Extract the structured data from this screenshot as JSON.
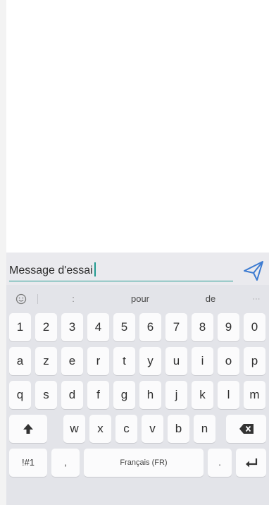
{
  "message": {
    "value": "Message d'essai"
  },
  "suggestions": {
    "left": ":",
    "center": "pour",
    "right": "de",
    "more": "···"
  },
  "keyboard": {
    "row_numbers": [
      "1",
      "2",
      "3",
      "4",
      "5",
      "6",
      "7",
      "8",
      "9",
      "0"
    ],
    "row_1": [
      "a",
      "z",
      "e",
      "r",
      "t",
      "y",
      "u",
      "i",
      "o",
      "p"
    ],
    "row_2": [
      "q",
      "s",
      "d",
      "f",
      "g",
      "h",
      "j",
      "k",
      "l",
      "m"
    ],
    "row_3": [
      "w",
      "x",
      "c",
      "v",
      "b",
      "n"
    ],
    "symbols_label": "!#1",
    "comma_label": ",",
    "space_label": "Français (FR)",
    "period_label": "."
  },
  "icons": {
    "send": "send-icon",
    "emoji": "emoji-icon",
    "shift": "shift-icon",
    "backspace": "backspace-icon",
    "enter": "enter-icon"
  },
  "colors": {
    "accent": "#1f9a8f",
    "send": "#3c7bd1"
  }
}
